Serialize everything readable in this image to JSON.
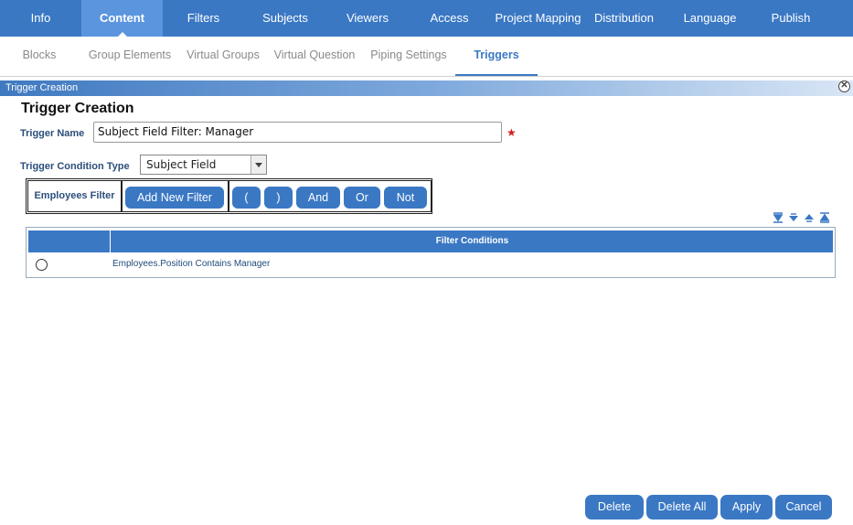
{
  "top_nav": {
    "items": [
      {
        "label": "Info"
      },
      {
        "label": "Content"
      },
      {
        "label": "Filters"
      },
      {
        "label": "Subjects"
      },
      {
        "label": "Viewers"
      },
      {
        "label": "Access"
      },
      {
        "label": "Project Mapping"
      },
      {
        "label": "Distribution"
      },
      {
        "label": "Language"
      },
      {
        "label": "Publish"
      }
    ],
    "active": "Content"
  },
  "sub_nav": {
    "items": [
      {
        "label": "Blocks"
      },
      {
        "label": "Group Elements"
      },
      {
        "label": "Virtual Groups"
      },
      {
        "label": "Virtual Question"
      },
      {
        "label": "Piping Settings"
      },
      {
        "label": "Triggers"
      }
    ],
    "active": "Triggers"
  },
  "panel": {
    "header": "Trigger Creation",
    "title": "Trigger Creation",
    "close_icon": "close-circle-icon"
  },
  "form": {
    "name_label": "Trigger Name",
    "name_value": "Subject Field Filter: Manager",
    "required_mark": "★",
    "condition_type_label": "Trigger Condition Type",
    "condition_type_value": "Subject Field"
  },
  "filter_bar": {
    "label": "Employees Filter",
    "add_button": "Add New Filter",
    "open_paren": "(",
    "close_paren": ")",
    "and": "And",
    "or": "Or",
    "not": "Not"
  },
  "sort_icons": [
    "move-bottom-icon",
    "move-down-icon",
    "move-up-icon",
    "move-top-icon"
  ],
  "grid": {
    "header": "Filter Conditions",
    "rows": [
      {
        "condition": "Employees.Position Contains Manager"
      }
    ]
  },
  "actions": {
    "delete": "Delete",
    "delete_all": "Delete All",
    "apply": "Apply",
    "cancel": "Cancel"
  },
  "colors": {
    "primary": "#3a78c4",
    "active_tab": "#5b95de",
    "required": "#d02020"
  }
}
